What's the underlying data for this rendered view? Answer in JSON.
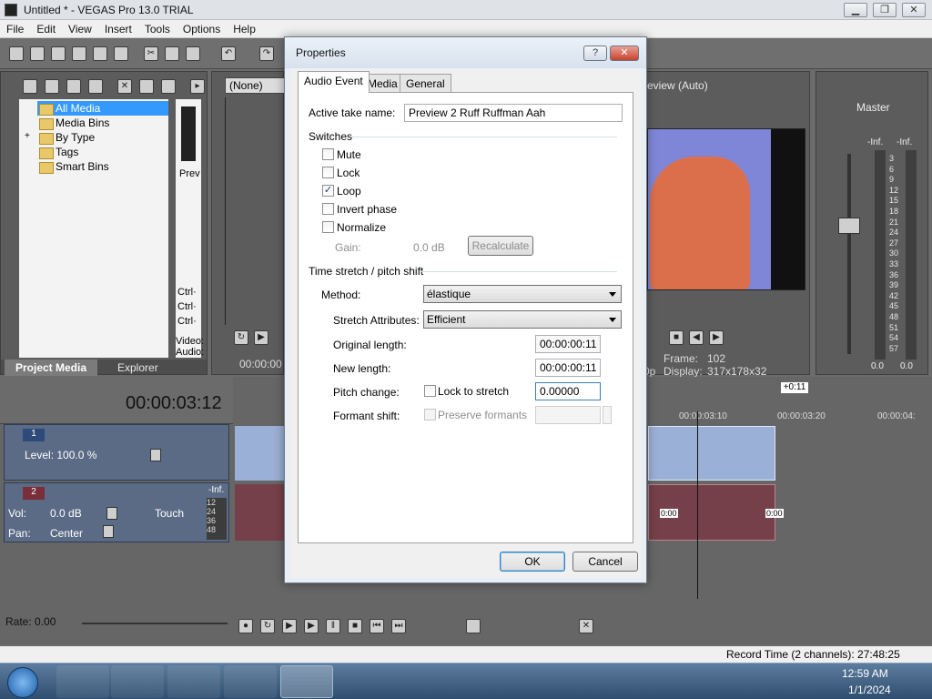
{
  "window": {
    "title": "Untitled * - VEGAS Pro 13.0 TRIAL",
    "minimize": "▁",
    "maximize": "❐",
    "close": "✕"
  },
  "menu": [
    "File",
    "Edit",
    "View",
    "Insert",
    "Tools",
    "Options",
    "Help"
  ],
  "project_media": {
    "tree": [
      "All Media",
      "Media Bins",
      "By Type",
      "Tags",
      "Smart Bins"
    ],
    "expander": "+",
    "preview_label": "Prev",
    "ctrl_labels": [
      "Ctrl·",
      "Ctrl·",
      "Ctrl·"
    ],
    "video_label": "Video:",
    "audio_label": "Audio:",
    "tabs": [
      "Project Media",
      "Explorer"
    ]
  },
  "trimmer": {
    "dropdown": "(None)",
    "time": "00:00:00"
  },
  "preview": {
    "mode": "review (Auto)",
    "frame_label": "Frame:",
    "frame_value": "102",
    "display_label": "Display:",
    "display_value": "317x178x32",
    "p_label": "0p"
  },
  "master": {
    "label": "Master",
    "inf_left": "-Inf.",
    "inf_right": "-Inf.",
    "scale": [
      "3",
      "6",
      "9",
      "12",
      "15",
      "18",
      "21",
      "24",
      "27",
      "30",
      "33",
      "36",
      "39",
      "42",
      "45",
      "48",
      "51",
      "54",
      "57"
    ],
    "value_left": "0.0",
    "value_right": "0.0"
  },
  "timeline": {
    "time_display": "00:00:03:12",
    "ruler_marks": [
      "00:00:03:10",
      "00:00:03:20",
      "00:00:04:"
    ],
    "loop_region": "+0:11",
    "video_track": {
      "number": "1",
      "level": "Level: 100.0 %"
    },
    "audio_track": {
      "number": "2",
      "vol_label": "Vol:",
      "vol_value": "0.0 dB",
      "pan_label": "Pan:",
      "pan_value": "Center",
      "touch": "Touch",
      "inf": "-Inf.",
      "meter": [
        "12",
        "24",
        "36",
        "48"
      ]
    },
    "fade_labels": [
      "0:00",
      "0:00"
    ],
    "rate": "Rate: 0.00"
  },
  "status": {
    "record_time": "Record Time (2 channels): 27:48:25"
  },
  "dialog": {
    "title": "Properties",
    "help_btn": "?",
    "close_btn": "✕",
    "tabs": [
      "Audio Event",
      "Media",
      "General"
    ],
    "active_take_label": "Active take name:",
    "active_take_value": "Preview 2 Ruff Ruffman Aah",
    "switches_label": "Switches",
    "switches": [
      {
        "label": "Mute",
        "checked": false
      },
      {
        "label": "Lock",
        "checked": false
      },
      {
        "label": "Loop",
        "checked": true
      },
      {
        "label": "Invert phase",
        "checked": false
      },
      {
        "label": "Normalize",
        "checked": false
      }
    ],
    "gain_label": "Gain:",
    "gain_value": "0.0 dB",
    "recalculate": "Recalculate",
    "stretch_label": "Time stretch / pitch shift",
    "method_label": "Method:",
    "method_value": "élastique",
    "stretch_attr_label": "Stretch Attributes:",
    "stretch_attr_value": "Efficient",
    "orig_len_label": "Original length:",
    "orig_len_value": "00:00:00:11",
    "new_len_label": "New length:",
    "new_len_value": "00:00:00:11",
    "pitch_label": "Pitch change:",
    "lock_stretch": "Lock to stretch",
    "pitch_value": "0.00000",
    "formant_label": "Formant shift:",
    "preserve_formants": "Preserve formants",
    "ok": "OK",
    "cancel": "Cancel"
  },
  "taskbar": {
    "time": "12:59 AM",
    "date": "1/1/2024"
  }
}
